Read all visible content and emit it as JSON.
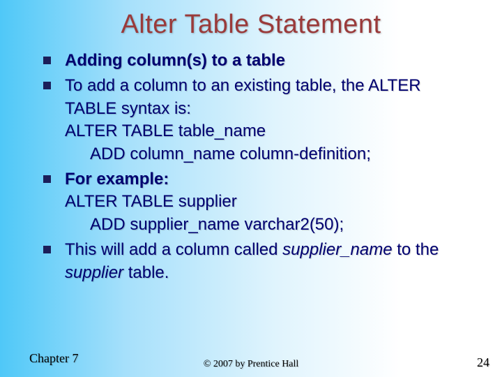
{
  "title": "Alter Table Statement",
  "bullets": {
    "b1": "Adding column(s) to a table",
    "b2": {
      "l1": "To add a column to an existing table, the ALTER TABLE syntax is:",
      "l2": "ALTER TABLE table_name",
      "l3": "ADD column_name column-definition;"
    },
    "b3": {
      "label": "For example:",
      "l1": "ALTER TABLE supplier",
      "l2": "ADD supplier_name  varchar2(50);"
    },
    "b4": {
      "t1": "This will add a column called ",
      "i1": "supplier_name ",
      "t2": " to the ",
      "i2": "supplier ",
      "t3": " table."
    }
  },
  "footer": {
    "left": "Chapter 7",
    "center": "© 2007 by Prentice Hall",
    "right": "24"
  }
}
